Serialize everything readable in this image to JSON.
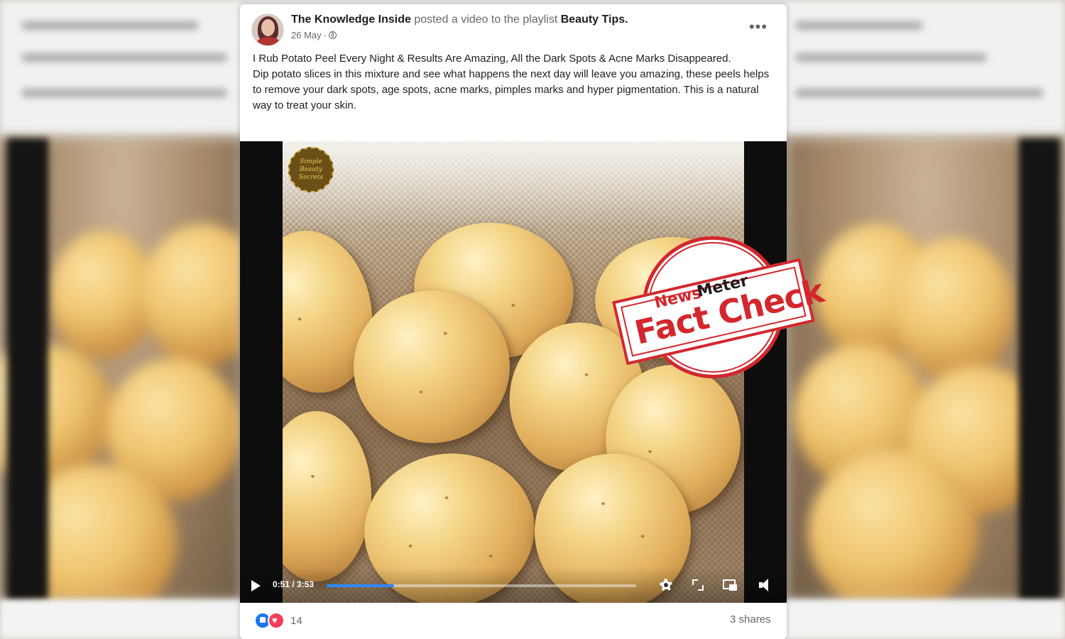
{
  "post": {
    "author": "The Knowledge Inside",
    "action_text": "posted a video to the playlist",
    "playlist": "Beauty Tips.",
    "date": "26 May",
    "separator": "·",
    "text_line1": "I Rub Potato Peel Every Night & Results Are Amazing, All the Dark Spots & Acne Marks Disappeared.",
    "text_line2": "Dip potato slices in this mixture and see what happens the next day will leave you amazing, these peels helps to remove your dark spots, age spots, acne marks, pimples marks and hyper pigmentation. This is a natural way to treat your skin.",
    "more_label": "•••"
  },
  "video": {
    "current_time": "0:51",
    "duration": "3:53",
    "time_separator": " / ",
    "progress": 0.219,
    "watermark_text": "Simple Beauty Secrets"
  },
  "reactions": {
    "count": "14",
    "shares": "3 shares",
    "icons": [
      "like-icon",
      "love-icon"
    ]
  },
  "stamp": {
    "news": "News",
    "meter": "Meter",
    "fact_check": "Fact Check"
  },
  "colors": {
    "facebook_blue": "#1877f2",
    "progress_blue": "#2d88ff",
    "stamp_red": "#d3272d",
    "love_red": "#f33e58"
  }
}
